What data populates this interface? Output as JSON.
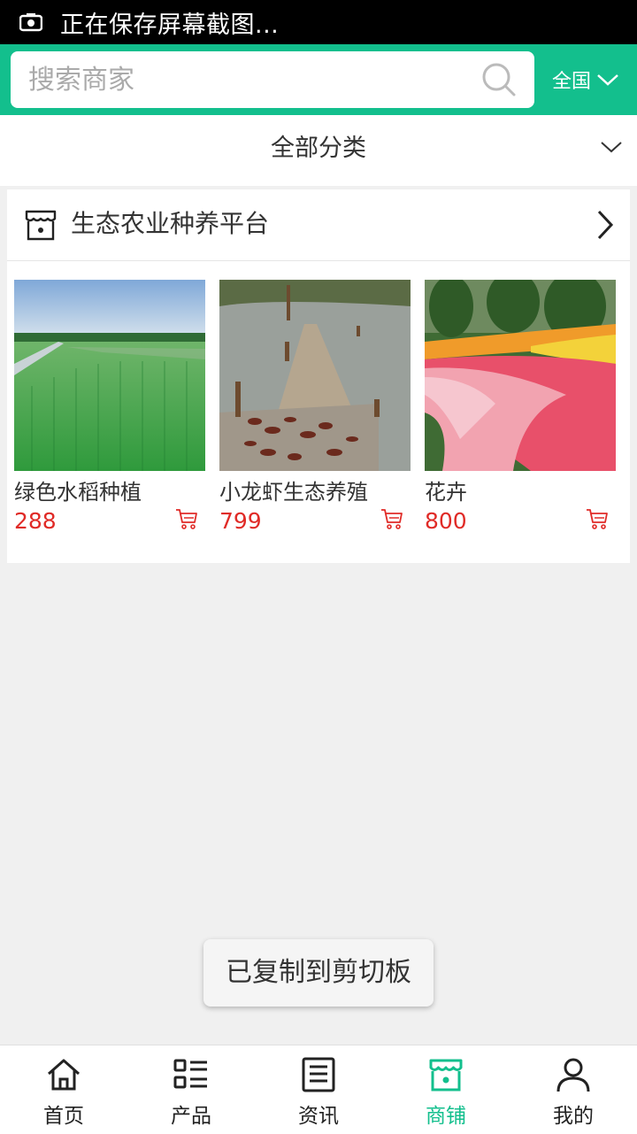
{
  "status_bar": {
    "text": "正在保存屏幕截图..."
  },
  "header": {
    "search_placeholder": "搜索商家",
    "region": "全国",
    "brand_color": "#13bf8d"
  },
  "category": {
    "label": "全部分类"
  },
  "shop": {
    "name": "生态农业种养平台",
    "products": [
      {
        "title": "绿色水稻种植",
        "price": "288"
      },
      {
        "title": "小龙虾生态养殖",
        "price": "799"
      },
      {
        "title": "花卉",
        "price": "800"
      }
    ]
  },
  "toast": {
    "text": "已复制到剪切板"
  },
  "tabbar": {
    "items": [
      {
        "label": "首页",
        "icon": "home-icon"
      },
      {
        "label": "产品",
        "icon": "list-icon"
      },
      {
        "label": "资讯",
        "icon": "news-icon"
      },
      {
        "label": "商铺",
        "icon": "store-icon",
        "active": true
      },
      {
        "label": "我的",
        "icon": "user-icon"
      }
    ]
  }
}
